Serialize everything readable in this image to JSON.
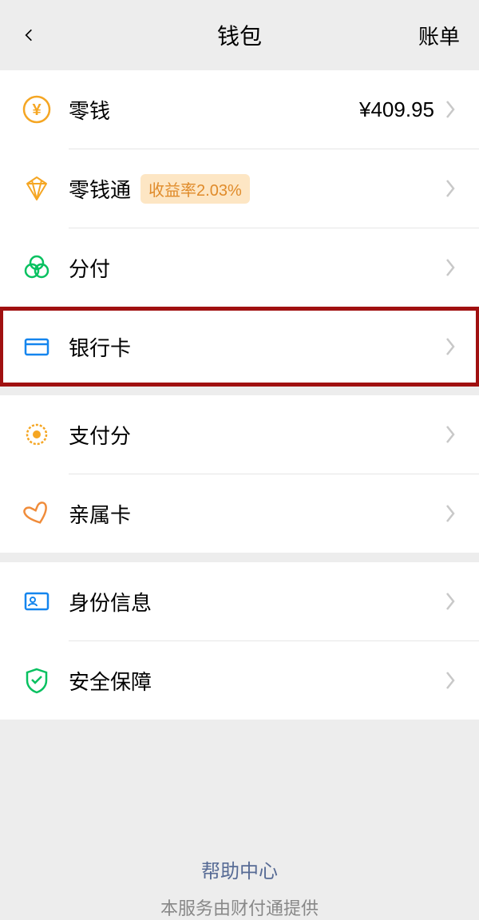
{
  "header": {
    "title": "钱包",
    "right": "账单"
  },
  "sections": {
    "balance": {
      "label": "零钱",
      "value": "¥409.95"
    },
    "balancePlus": {
      "label": "零钱通",
      "badge": "收益率2.03%"
    },
    "fenfu": {
      "label": "分付"
    },
    "bankCard": {
      "label": "银行卡"
    },
    "payScore": {
      "label": "支付分"
    },
    "familyCard": {
      "label": "亲属卡"
    },
    "identity": {
      "label": "身份信息"
    },
    "security": {
      "label": "安全保障"
    }
  },
  "footer": {
    "link": "帮助中心",
    "provider": "本服务由财付通提供"
  }
}
